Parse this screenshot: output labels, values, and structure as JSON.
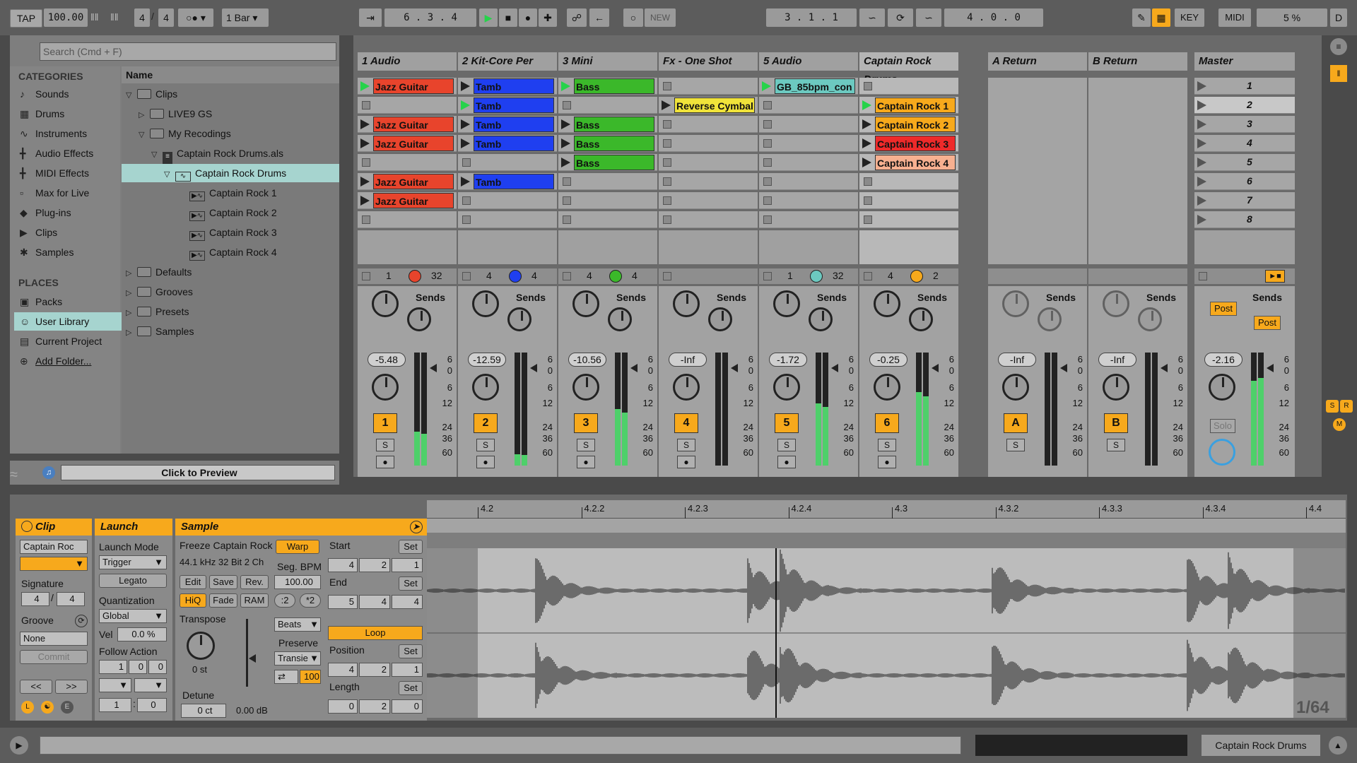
{
  "transport": {
    "tap": "TAP",
    "tempo": "100.00",
    "sig_num": "4",
    "sig_den": "4",
    "quantize": "1 Bar",
    "position": "6 .   3 .   4",
    "new_label": "NEW",
    "loop_start": "3 .   1 .   1",
    "loop_length": "4 .   0 .   0",
    "key_label": "KEY",
    "midi_label": "MIDI",
    "cpu": "5 %",
    "d_label": "D"
  },
  "browser": {
    "search_placeholder": "Search (Cmd + F)",
    "categories_title": "CATEGORIES",
    "categories": [
      "Sounds",
      "Drums",
      "Instruments",
      "Audio Effects",
      "MIDI Effects",
      "Max for Live",
      "Plug-ins",
      "Clips",
      "Samples"
    ],
    "places_title": "PLACES",
    "places": [
      "Packs",
      "User Library",
      "Current Project",
      "Add Folder..."
    ],
    "name_header": "Name",
    "tree": [
      "Clips",
      "LIVE9 GS",
      "My Recodings",
      "Captain Rock Drums.als",
      "Captain Rock Drums",
      "Captain Rock 1",
      "Captain Rock 2",
      "Captain Rock 3",
      "Captain Rock 4",
      "Defaults",
      "Grooves",
      "Presets",
      "Samples"
    ],
    "preview": "Click to Preview"
  },
  "tracks": [
    {
      "name": "1 Audio",
      "num": "1",
      "color": "#e8442c",
      "in": "1",
      "out": "32",
      "vol": "-5.48",
      "meter": 0.3
    },
    {
      "name": "2 Kit-Core Per",
      "num": "2",
      "color": "#1f3ff0",
      "in": "4",
      "out": "4",
      "vol": "-12.59",
      "meter": 0.1
    },
    {
      "name": "3 Mini",
      "num": "3",
      "color": "#3bb82a",
      "in": "4",
      "out": "4",
      "vol": "-10.56",
      "meter": 0.5
    },
    {
      "name": "Fx - One Shot",
      "num": "4",
      "color": "#f0e33a",
      "in": "",
      "out": "",
      "vol": "-Inf",
      "meter": 0
    },
    {
      "name": "5 Audio",
      "num": "5",
      "color": "#6cc9c0",
      "in": "1",
      "out": "32",
      "vol": "-1.72",
      "meter": 0.55
    },
    {
      "name": "Captain Rock Drums",
      "num": "6",
      "color": "#f7a91c",
      "in": "4",
      "out": "2",
      "vol": "-0.25",
      "meter": 0.65
    }
  ],
  "returns": [
    {
      "name": "A Return",
      "num": "A",
      "vol": "-Inf"
    },
    {
      "name": "B Return",
      "num": "B",
      "vol": "-Inf"
    }
  ],
  "master": {
    "name": "Master",
    "vol": "-2.16",
    "scenes": [
      "1",
      "2",
      "3",
      "4",
      "5",
      "6",
      "7",
      "8"
    ],
    "post1": "Post",
    "post2": "Post",
    "solo": "Solo"
  },
  "clips": {
    "t1": [
      "Jazz Guitar",
      "",
      "Jazz Guitar",
      "Jazz Guitar",
      "",
      "Jazz Guitar",
      "Jazz Guitar",
      ""
    ],
    "t2": [
      "Tamb",
      "Tamb",
      "Tamb",
      "Tamb",
      "",
      "Tamb",
      "",
      ""
    ],
    "t3": [
      "Bass",
      "",
      "Bass",
      "Bass",
      "Bass",
      "",
      "",
      ""
    ],
    "t4": [
      "",
      "Reverse Cymbal",
      "",
      "",
      "",
      "",
      "",
      ""
    ],
    "t5": [
      "GB_85bpm_con",
      "",
      "",
      "",
      "",
      "",
      "",
      ""
    ],
    "t6": [
      "",
      "Captain Rock 1",
      "Captain Rock 2",
      "Captain Rock 3",
      "Captain Rock 4",
      "",
      "",
      ""
    ]
  },
  "mixer": {
    "sends": "Sends",
    "s": "S",
    "scale": [
      "6",
      "0",
      "6",
      "12",
      "24",
      "36",
      "60"
    ]
  },
  "clipview": {
    "clip_title": "Clip",
    "clip_name": "Captain Roc",
    "signature": "Signature",
    "sig_n": "4",
    "sig_d": "4",
    "groove": "Groove",
    "groove_val": "None",
    "commit": "Commit",
    "nav_prev": "<<",
    "nav_next": ">>",
    "launch_title": "Launch",
    "launch_mode": "Launch Mode",
    "trigger": "Trigger",
    "legato": "Legato",
    "quantization": "Quantization",
    "global": "Global",
    "vel_label": "Vel",
    "vel": "0.0 %",
    "follow": "Follow Action",
    "fa1": "1",
    "fa2": "0",
    "fa3": "0",
    "fb1": "1",
    "fb2": "0",
    "sample_title": "Sample",
    "sample_name": "Freeze Captain Rock",
    "sample_info": "44.1 kHz 32 Bit 2 Ch",
    "edit": "Edit",
    "save": "Save",
    "rev": "Rev.",
    "hiq": "HiQ",
    "fade": "Fade",
    "ram": "RAM",
    "transpose": "Transpose",
    "trans_val": "0 st",
    "detune": "Detune",
    "det_val": "0 ct",
    "gain": "0.00 dB",
    "warp": "Warp",
    "seg_bpm": "Seg. BPM",
    "bpm": "100.00",
    "half": ":2",
    "double": "*2",
    "beats": "Beats",
    "preserve": "Preserve",
    "transients": "Transie",
    "hundred": "100",
    "start": "Start",
    "set": "Set",
    "st": [
      "4",
      "2",
      "1"
    ],
    "end": "End",
    "en": [
      "5",
      "4",
      "4"
    ],
    "loop": "Loop",
    "position": "Position",
    "po": [
      "4",
      "2",
      "1"
    ],
    "length": "Length",
    "le": [
      "0",
      "2",
      "0"
    ]
  },
  "wave": {
    "ruler": [
      "4.2",
      "4.2.2",
      "4.2.3",
      "4.2.4",
      "4.3",
      "4.3.2",
      "4.3.3",
      "4.3.4",
      "4.4"
    ],
    "zoom": "1/64"
  },
  "status": {
    "track": "Captain Rock Drums"
  }
}
